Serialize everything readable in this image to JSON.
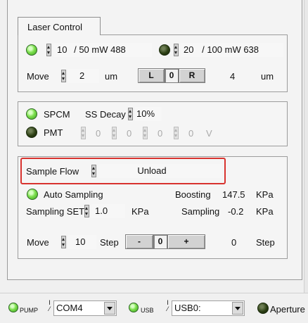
{
  "laser_control": {
    "title": "Laser Control",
    "laser1": {
      "power": "10",
      "spec": "/ 50 mW 488"
    },
    "laser2": {
      "power": "20",
      "spec": "/ 100 mW 638"
    },
    "move_label": "Move",
    "move_value": "2",
    "move_unit": "um",
    "btn_left": "L",
    "btn_zero": "0",
    "btn_right": "R",
    "position_value": "4",
    "position_unit": "um"
  },
  "detectors": {
    "spcm_label": "SPCM",
    "ss_decay_label": "SS Decay",
    "ss_decay_value": "10%",
    "pmt_label": "PMT",
    "pmt_values": [
      "0",
      "0",
      "0",
      "0"
    ],
    "pmt_unit": "V"
  },
  "sample": {
    "flow_label": "Sample Flow",
    "flow_value": "Unload",
    "auto_label": "Auto Sampling",
    "boosting_label": "Boosting",
    "boosting_value": "147.5",
    "boosting_unit": "KPa",
    "set_label": "Sampling SET",
    "set_value": "1.0",
    "set_unit": "KPa",
    "sampling_label": "Sampling",
    "sampling_value": "-0.2",
    "sampling_unit": "KPa",
    "move_label": "Move",
    "move_value": "10",
    "step_label": "Step",
    "btn_minus": "-",
    "btn_zero": "0",
    "btn_plus": "+",
    "step_value": "0",
    "step_unit": "Step"
  },
  "statusbar": {
    "pump_label": "PUMP",
    "com_value": "COM4",
    "usb_label": "USB",
    "usb_value": "USB0:",
    "aperture_label": "Aperture"
  },
  "colors": {
    "led_on": "#56c12f",
    "led_off": "#24360f",
    "highlight": "#d8332f"
  }
}
